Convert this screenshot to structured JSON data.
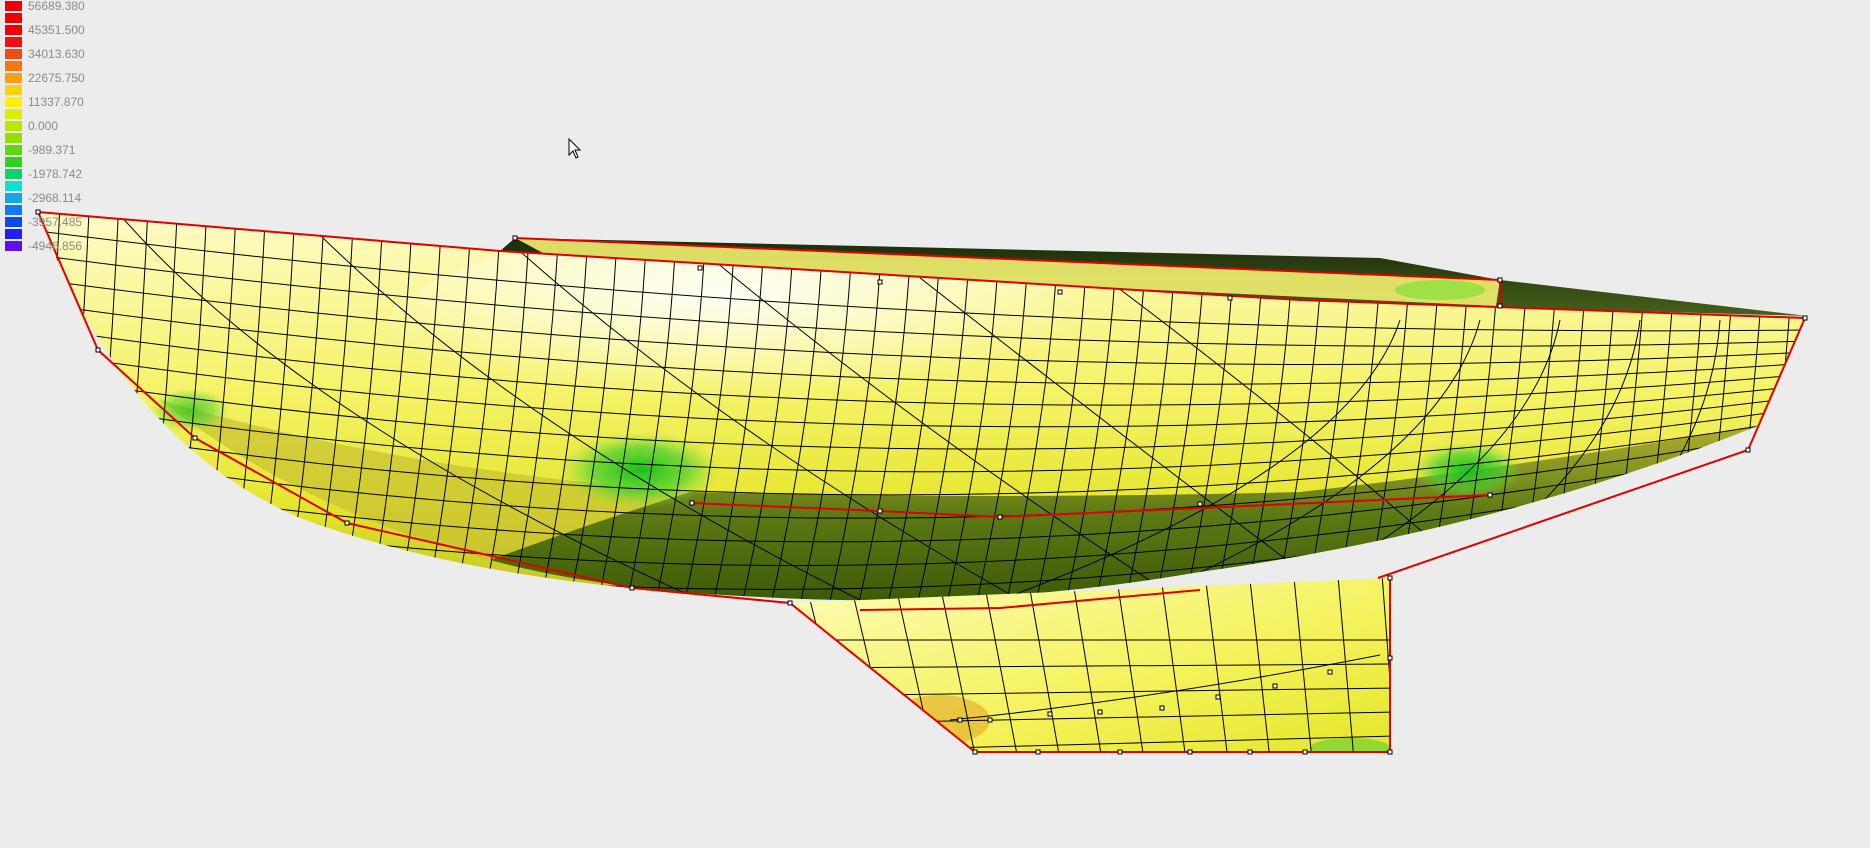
{
  "legend": {
    "entries": [
      {
        "color": "#f00000",
        "label": "56689.380"
      },
      {
        "color": "#f00000",
        "label": ""
      },
      {
        "color": "#f00000",
        "label": "45351.500"
      },
      {
        "color": "#f01010",
        "label": ""
      },
      {
        "color": "#f04a10",
        "label": "34013.630"
      },
      {
        "color": "#f47a10",
        "label": ""
      },
      {
        "color": "#f8a010",
        "label": "22675.750"
      },
      {
        "color": "#ffd010",
        "label": ""
      },
      {
        "color": "#fff000",
        "label": "11337.870"
      },
      {
        "color": "#d8f000",
        "label": ""
      },
      {
        "color": "#b8e800",
        "label": "0.000"
      },
      {
        "color": "#90e000",
        "label": ""
      },
      {
        "color": "#60d810",
        "label": "-989.371"
      },
      {
        "color": "#30d020",
        "label": ""
      },
      {
        "color": "#10d070",
        "label": "-1978.742"
      },
      {
        "color": "#10e0d0",
        "label": ""
      },
      {
        "color": "#10a8e8",
        "label": "-2968.114"
      },
      {
        "color": "#1078f0",
        "label": ""
      },
      {
        "color": "#1048f0",
        "label": "-3957.485"
      },
      {
        "color": "#2020f0",
        "label": ""
      },
      {
        "color": "#6010f0",
        "label": "-4946.856"
      }
    ]
  },
  "colors": {
    "background": "#ececec",
    "hull_light": "#fdfbc8",
    "hull_yellow": "#f4f24a",
    "hull_shadow": "#4e6a10",
    "high_pressure": "#2ad41c",
    "control_polygon": "#e00000",
    "mesh_lines": "#000000"
  },
  "icons": {
    "cursor": "arrow-cursor-icon"
  }
}
